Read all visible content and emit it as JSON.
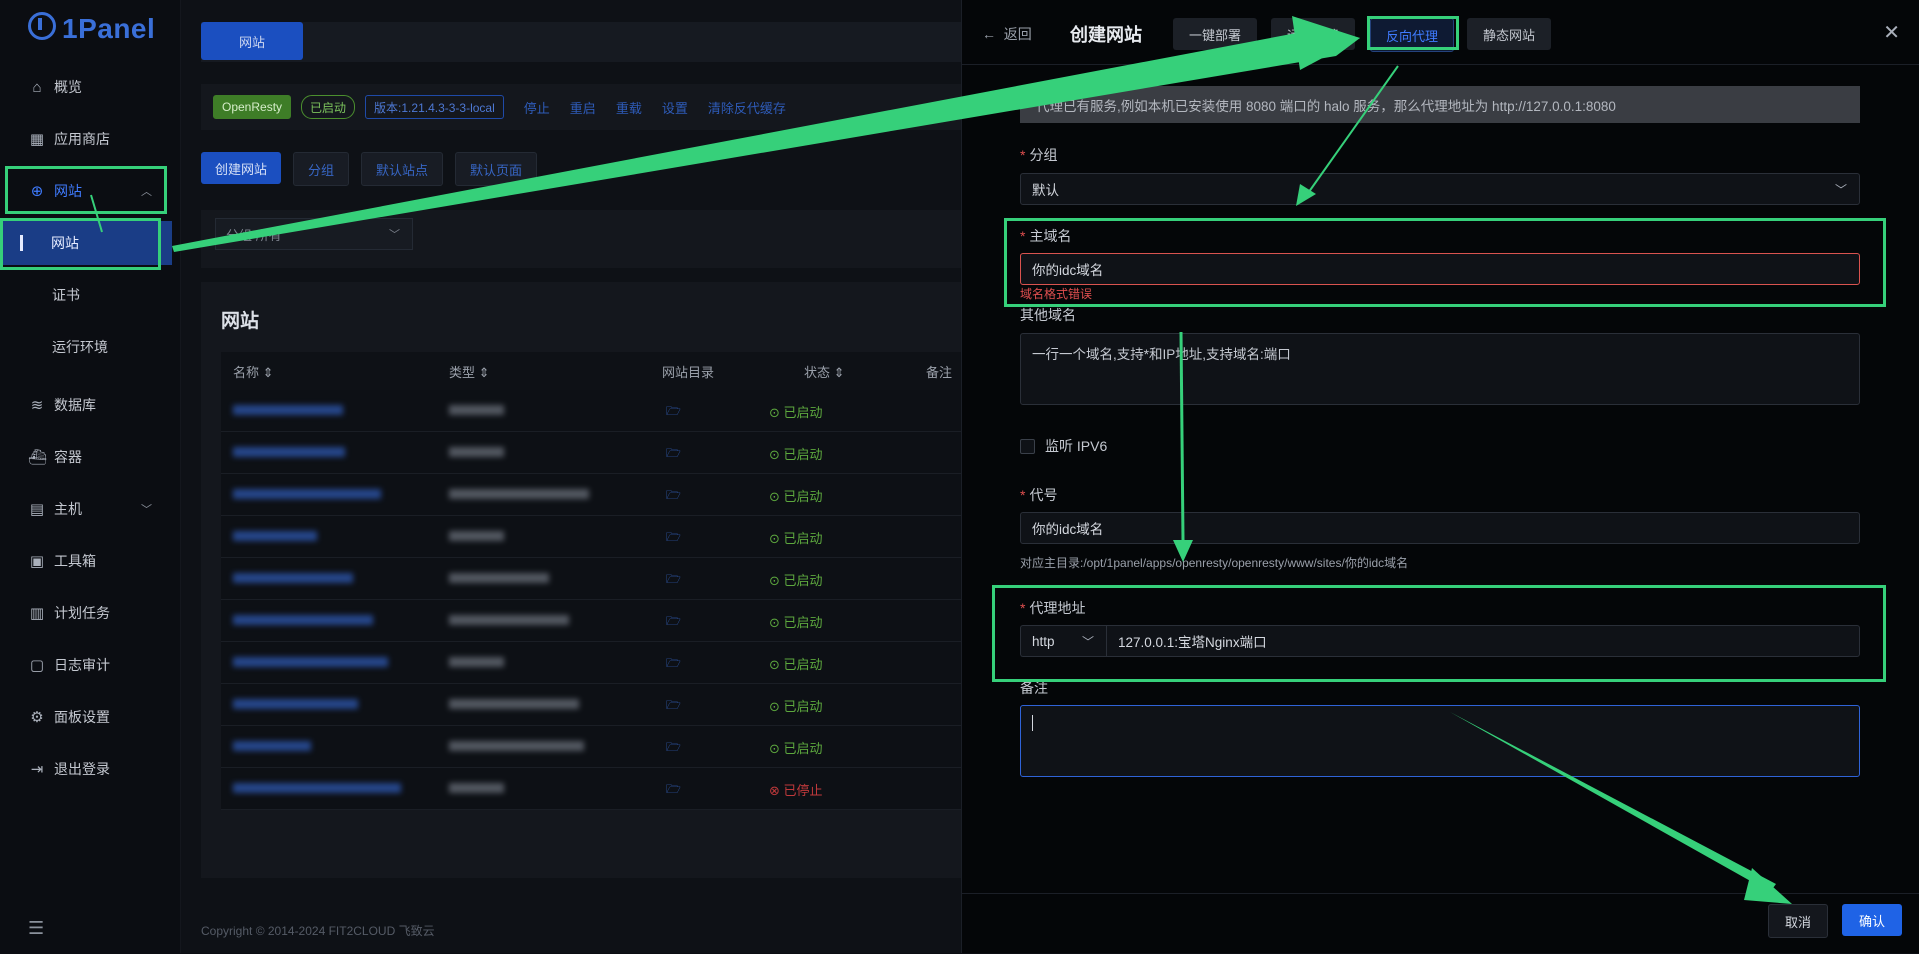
{
  "sidebar": {
    "logo": "1Panel",
    "items": [
      {
        "label": "概览",
        "icon": "home-icon"
      },
      {
        "label": "应用商店",
        "icon": "grid-icon"
      },
      {
        "label": "网站",
        "icon": "globe-icon"
      },
      {
        "label": "数据库",
        "icon": "layers-icon"
      },
      {
        "label": "容器",
        "icon": "docker-icon"
      },
      {
        "label": "主机",
        "icon": "server-icon"
      },
      {
        "label": "工具箱",
        "icon": "toolbox-icon"
      },
      {
        "label": "计划任务",
        "icon": "calendar-icon"
      },
      {
        "label": "日志审计",
        "icon": "log-icon"
      },
      {
        "label": "面板设置",
        "icon": "gear-icon"
      },
      {
        "label": "退出登录",
        "icon": "logout-icon"
      }
    ],
    "sub_items": [
      {
        "label": "网站"
      },
      {
        "label": "证书"
      },
      {
        "label": "运行环境"
      }
    ]
  },
  "main": {
    "tab": "网站",
    "status": {
      "app": "OpenResty",
      "state": "已启动",
      "version": "版本:1.21.4.3-3-3-local",
      "actions": [
        "停止",
        "重启",
        "重载",
        "设置",
        "清除反代缓存"
      ]
    },
    "buttons": [
      "创建网站",
      "分组",
      "默认站点",
      "默认页面"
    ],
    "filter": "分组  所有",
    "list_title": "网站",
    "columns": [
      "名称",
      "类型",
      "网站目录",
      "状态",
      "备注"
    ],
    "rows": [
      {
        "status": "已启动"
      },
      {
        "status": "已启动"
      },
      {
        "status": "已启动"
      },
      {
        "status": "已启动"
      },
      {
        "status": "已启动"
      },
      {
        "status": "已启动"
      },
      {
        "status": "已启动"
      },
      {
        "status": "已启动"
      },
      {
        "status": "已启动"
      },
      {
        "status": "已停止"
      }
    ],
    "copyright": "Copyright © 2014-2024 FIT2CLOUD 飞致云"
  },
  "drawer": {
    "back": "返回",
    "title": "创建网站",
    "tabs": [
      "一键部署",
      "运行环境",
      "反向代理",
      "静态网站"
    ],
    "alert": "代理已有服务,例如本机已安装使用 8080 端口的 halo 服务，那么代理地址为 http://127.0.0.1:8080",
    "group_label": "分组",
    "group_value": "默认",
    "primary_domain_label": "主域名",
    "primary_domain_value": "你的idc域名",
    "primary_domain_error": "域名格式错误",
    "other_domains_label": "其他域名",
    "other_domains_placeholder": "一行一个域名,支持*和IP地址,支持域名:端口",
    "ipv6_label": "监听 IPV6",
    "alias_label": "代号",
    "alias_value": "你的idc域名",
    "alias_hint": "对应主目录:/opt/1panel/apps/openresty/openresty/www/sites/你的idc域名",
    "proxy_label": "代理地址",
    "proxy_protocol": "http",
    "proxy_value": "127.0.0.1:宝塔Nginx端口",
    "remark_label": "备注",
    "cancel": "取消",
    "confirm": "确认"
  },
  "colors": {
    "annotation": "#36d07a",
    "accent": "#1f63e6",
    "success": "#5da83e",
    "danger": "#e04f4f"
  }
}
